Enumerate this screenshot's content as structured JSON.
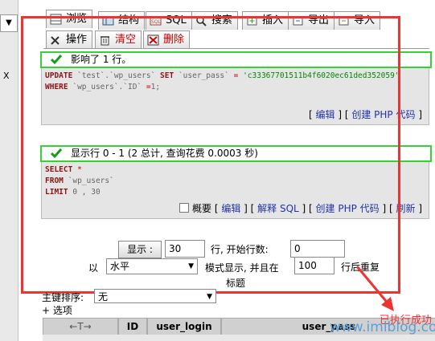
{
  "left_panel": {
    "dropdown_glyph": "▼",
    "close_label": "X"
  },
  "tabs": [
    {
      "label": "浏览"
    },
    {
      "label": "结构"
    },
    {
      "label": "SQL"
    },
    {
      "label": "搜索"
    },
    {
      "label": "插入"
    },
    {
      "label": "导出"
    },
    {
      "label": "导入"
    }
  ],
  "subtabs": [
    {
      "label": "操作"
    },
    {
      "label": "清空"
    },
    {
      "label": "删除"
    }
  ],
  "message1": "影响了 1 行。",
  "query1": {
    "line1": {
      "kw": "UPDATE",
      "rest_table": "`test`.`wp_users`",
      "kw2": "SET",
      "col": "`user_pass`",
      "op": "=",
      "value": "'c33367701511b4f6020ec61ded352059'"
    },
    "line2": {
      "kw": "WHERE",
      "col": "`wp_users`.`ID`",
      "op": "=",
      "value": "1;"
    }
  },
  "actions1": {
    "open": "[",
    "edit": "编辑",
    "sep": "] [",
    "create_php": "创建 PHP 代码",
    "close": "]"
  },
  "message2": "显示行 0 - 1 (2 总计, 查询花费 0.0003 秒)",
  "query2": {
    "line1": {
      "kw": "SELECT",
      "rest": "*"
    },
    "line2": {
      "kw": "FROM",
      "rest": "`wp_users`"
    },
    "line3": {
      "kw": "LIMIT",
      "rest": "0 , 30"
    }
  },
  "actions2": {
    "profile": "概要",
    "edit": "编辑",
    "explain": "解释 SQL",
    "create_php": "创建 PHP 代码",
    "refresh": "刷新"
  },
  "nav_form": {
    "show_button": "显示 :",
    "rows_value": "30",
    "rows_label": "行, 开始行数:",
    "start_value": "0",
    "with_label": "以",
    "mode_value": "水平",
    "mode_label": "模式显示, 并且在",
    "repeat_value": "100",
    "repeat_label": "行后重复",
    "header_label": "标题"
  },
  "sort": {
    "label": "主键排序:",
    "value": "无"
  },
  "options_link": "+ 选项",
  "table_headers": [
    "",
    "ID",
    "user_login",
    "user_pass"
  ],
  "arrows": "←T→",
  "watermark": "www.imlblog.com",
  "annotation": "已执行成功",
  "colors": {
    "highlight_box": "#e33333",
    "success_border": "#36d136",
    "keyword": "#8a1515",
    "link": "#2233aa"
  }
}
